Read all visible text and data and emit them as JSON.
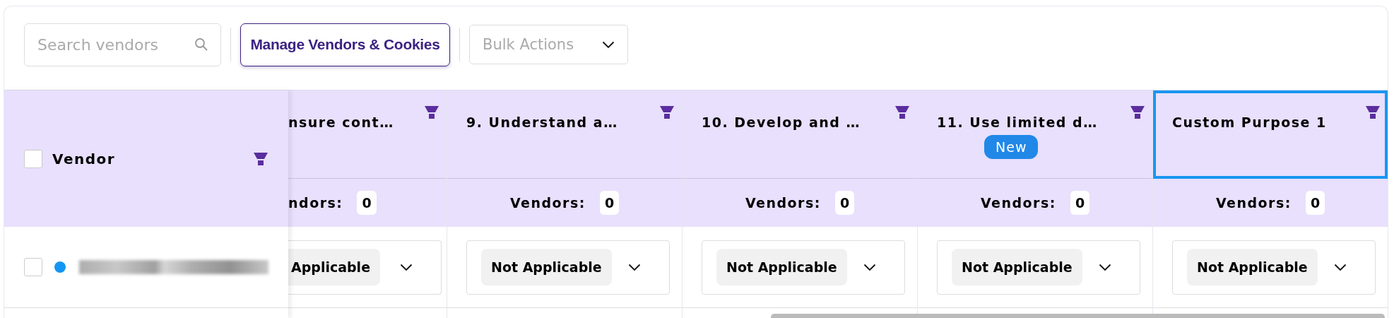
{
  "toolbar": {
    "search": {
      "placeholder": "Search vendors"
    },
    "manage_button": "Manage Vendors & Cookies",
    "bulk_actions": {
      "placeholder": "Bulk Actions"
    }
  },
  "table": {
    "vendor_column": {
      "label": "Vendor",
      "checked": false
    },
    "columns": [
      {
        "kind": "clipped",
        "title": "nsure cont…",
        "vendors_label": "ndors:",
        "count": "0",
        "selected": false
      },
      {
        "kind": "full",
        "title": "9. Understand a…",
        "vendors_label": "Vendors:",
        "count": "0",
        "selected": false
      },
      {
        "kind": "full",
        "title": "10. Develop and …",
        "vendors_label": "Vendors:",
        "count": "0",
        "selected": false
      },
      {
        "kind": "full",
        "title": "11. Use limited d…",
        "badge": "New",
        "vendors_label": "Vendors:",
        "count": "0",
        "selected": false
      },
      {
        "kind": "full",
        "title": "Custom Purpose 1",
        "vendors_label": "Vendors:",
        "count": "0",
        "selected": true
      }
    ],
    "rows": [
      {
        "checked": false,
        "color": "#1396f3",
        "values": [
          "Applicable",
          "Not Applicable",
          "Not Applicable",
          "Not Applicable",
          "Not Applicable"
        ]
      }
    ]
  }
}
